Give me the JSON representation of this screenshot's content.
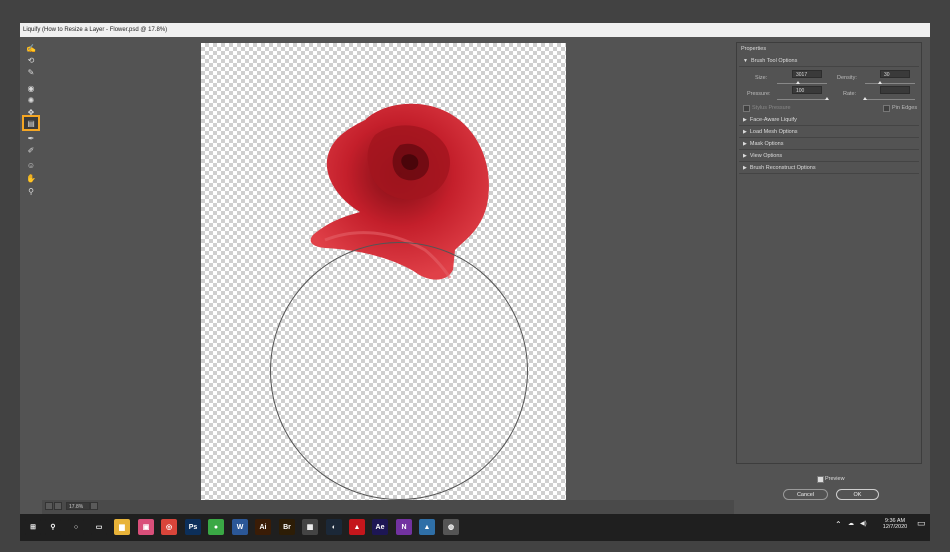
{
  "window": {
    "title": "Liquify (How to Resize a Layer - Flower.psd @ 17.8%)"
  },
  "toolbar": {
    "tools": [
      {
        "icon": "forward-warp-icon",
        "glyph": "✍"
      },
      {
        "icon": "reconstruct-icon",
        "glyph": "⟲"
      },
      {
        "icon": "smooth-icon",
        "glyph": "✎"
      },
      {
        "icon": "twirl-icon",
        "glyph": "◉"
      },
      {
        "icon": "pucker-icon",
        "glyph": "✺"
      },
      {
        "icon": "bloat-icon",
        "glyph": "✥"
      },
      {
        "icon": "push-left-icon",
        "glyph": "▤"
      },
      {
        "icon": "freeze-mask-icon",
        "glyph": "✒"
      },
      {
        "icon": "thaw-mask-icon",
        "glyph": "✐"
      },
      {
        "icon": "face-tool-icon",
        "glyph": "☺"
      },
      {
        "icon": "hand-icon",
        "glyph": "✋"
      },
      {
        "icon": "zoom-icon",
        "glyph": "⚲"
      }
    ],
    "active_index": 6
  },
  "status": {
    "zoom": "17.8%"
  },
  "properties": {
    "title": "Properties",
    "brush_tool_options": {
      "label": "Brush Tool Options",
      "size_label": "Size:",
      "size_value": "3017",
      "size_fraction": 0.42,
      "density_label": "Density:",
      "density_value": "30",
      "density_fraction": 0.3,
      "pressure_label": "Pressure:",
      "pressure_value": "100",
      "pressure_fraction": 1.0,
      "rate_label": "Rate:",
      "rate_value": "",
      "rate_fraction": 0.0,
      "stylus_pressure_label": "Stylus Pressure",
      "stylus_pressure_checked": false,
      "pin_edges_label": "Pin Edges",
      "pin_edges_checked": false
    },
    "sections": [
      "Face-Aware Liquify",
      "Load Mesh Options",
      "Mask Options",
      "View Options",
      "Brush Reconstruct Options"
    ]
  },
  "footer": {
    "preview_label": "Preview",
    "preview_checked": true,
    "cancel_label": "Cancel",
    "ok_label": "OK"
  },
  "taskbar": {
    "apps": [
      {
        "icon": "windows-start-icon",
        "glyph": "⊞",
        "color": "#1f1f1f"
      },
      {
        "icon": "search-icon",
        "glyph": "⚲",
        "color": "#1f1f1f"
      },
      {
        "icon": "cortana-icon",
        "glyph": "○",
        "color": "#1f1f1f"
      },
      {
        "icon": "task-view-icon",
        "glyph": "▭",
        "color": "#1f1f1f"
      },
      {
        "icon": "file-explorer-icon",
        "glyph": "▆",
        "color": "#e8b339"
      },
      {
        "icon": "photos-icon",
        "glyph": "▣",
        "color": "#d94f7a"
      },
      {
        "icon": "chrome-icon",
        "glyph": "◎",
        "color": "#d9453a"
      },
      {
        "icon": "photoshop-icon",
        "glyph": "Ps",
        "color": "#0c2f5a"
      },
      {
        "icon": "app-green-icon",
        "glyph": "●",
        "color": "#3aa845"
      },
      {
        "icon": "word-icon",
        "glyph": "W",
        "color": "#2b5797"
      },
      {
        "icon": "illustrator-icon",
        "glyph": "Ai",
        "color": "#3a1c06"
      },
      {
        "icon": "bridge-icon",
        "glyph": "Br",
        "color": "#2d1d06"
      },
      {
        "icon": "calculator-icon",
        "glyph": "▦",
        "color": "#444"
      },
      {
        "icon": "steam-icon",
        "glyph": "◐",
        "color": "#1b2838"
      },
      {
        "icon": "acrobat-icon",
        "glyph": "▲",
        "color": "#c4161c"
      },
      {
        "icon": "after-effects-icon",
        "glyph": "Ae",
        "color": "#1d1654"
      },
      {
        "icon": "onenote-icon",
        "glyph": "N",
        "color": "#7232a0"
      },
      {
        "icon": "app-landscape-icon",
        "glyph": "▲",
        "color": "#2f6fa7"
      },
      {
        "icon": "app-edge-icon",
        "glyph": "◍",
        "color": "#555"
      }
    ],
    "time": "9:36 AM",
    "date": "12/7/2020"
  }
}
